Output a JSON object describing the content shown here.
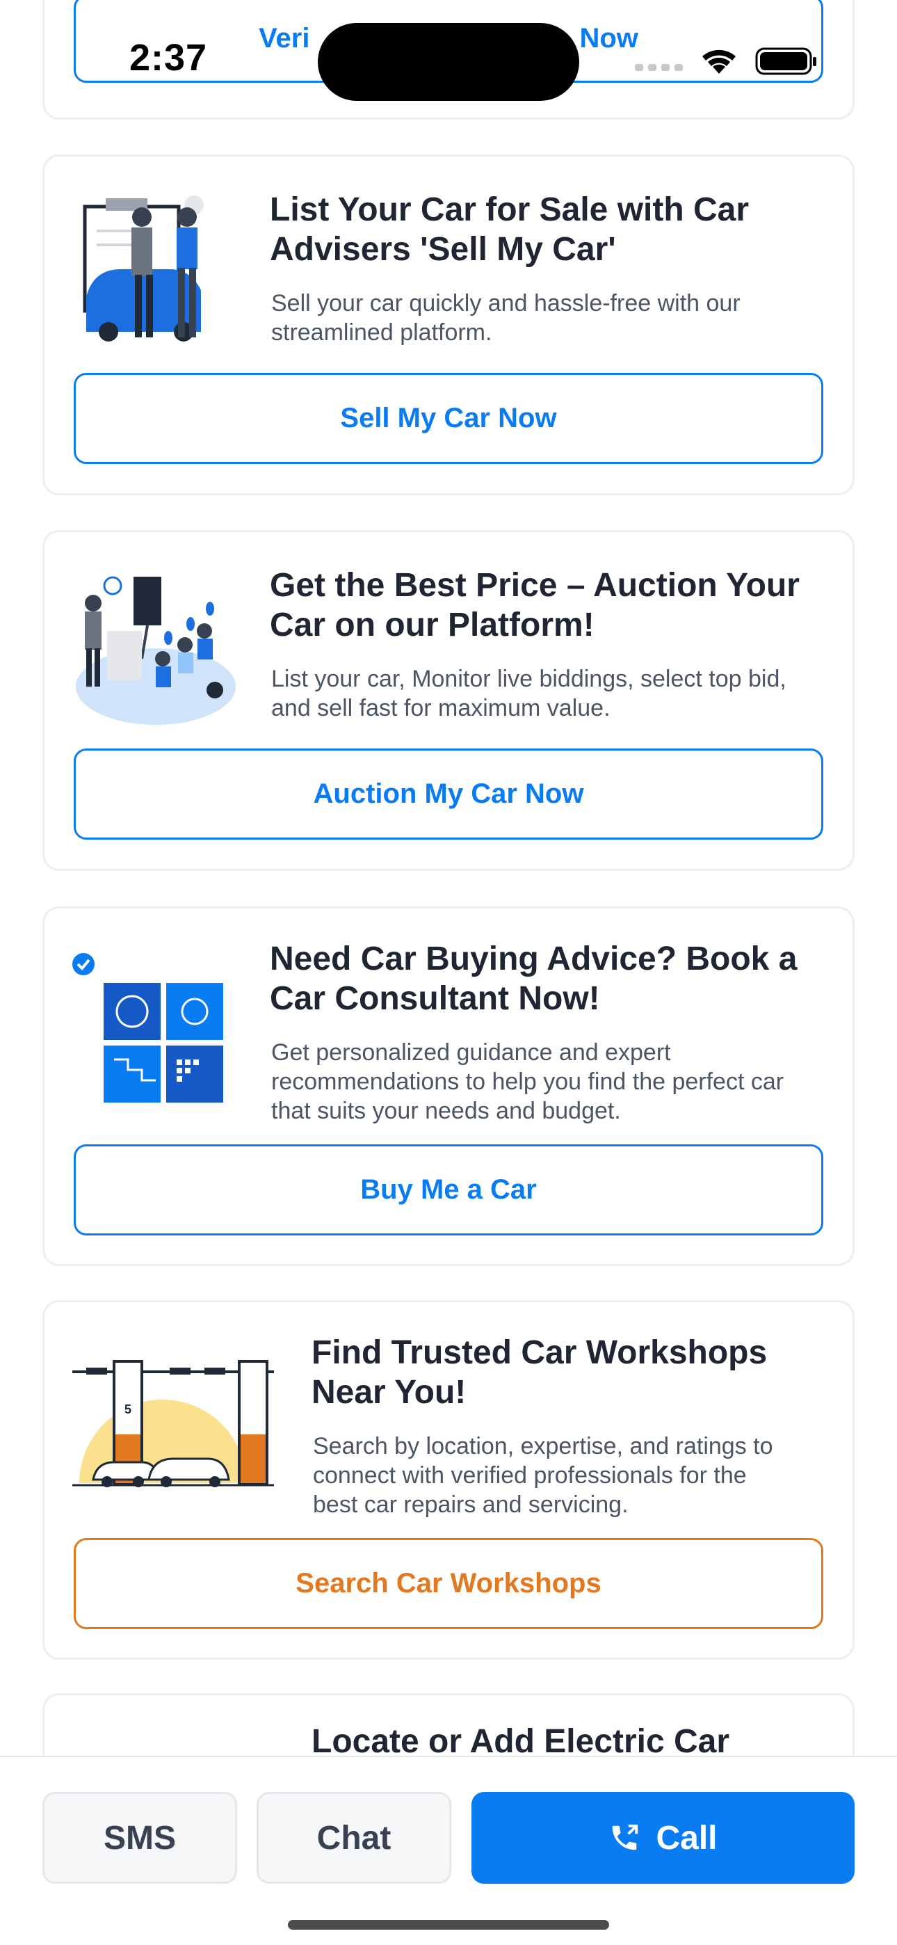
{
  "status_bar": {
    "time": "2:37"
  },
  "top_card": {
    "button_label_partial_left": "Veri",
    "button_label_partial_right": "Now"
  },
  "cards": [
    {
      "title_line1": "List Your Car for Sale with Car",
      "title_line2": "Advisers 'Sell My Car'",
      "desc_line1": "Sell your car quickly and hassle-free with our",
      "desc_line2": "streamlined platform.",
      "button": "Sell My Car Now"
    },
    {
      "title_line1": "Get the Best Price – Auction Your",
      "title_line2": "Car on our Platform!",
      "desc_line1": "List your car, Monitor live biddings, select top bid,",
      "desc_line2": "and sell fast for maximum value.",
      "button": "Auction My Car Now"
    },
    {
      "title_line1": "Need Car Buying Advice? Book a",
      "title_line2": "Car Consultant Now!",
      "desc_line1": "Get personalized guidance and expert",
      "desc_line2": "recommendations to help you find the perfect car",
      "desc_line3": "that suits your needs and budget.",
      "button": "Buy Me a Car"
    },
    {
      "title_line1": "Find Trusted Car Workshops",
      "title_line2": "Near You!",
      "desc_line1": "Search by location, expertise, and ratings to",
      "desc_line2": "connect with verified professionals for the",
      "desc_line3": "best car repairs and servicing.",
      "button": "Search Car Workshops",
      "workshop_bay_number": "5"
    },
    {
      "title_line1": "Locate or Add Electric Car"
    }
  ],
  "bottom_bar": {
    "sms": "SMS",
    "chat": "Chat",
    "call": "Call"
  },
  "colors": {
    "accent": "#0a7cf2",
    "orange": "#e2781f",
    "card_border": "#eceef1"
  }
}
